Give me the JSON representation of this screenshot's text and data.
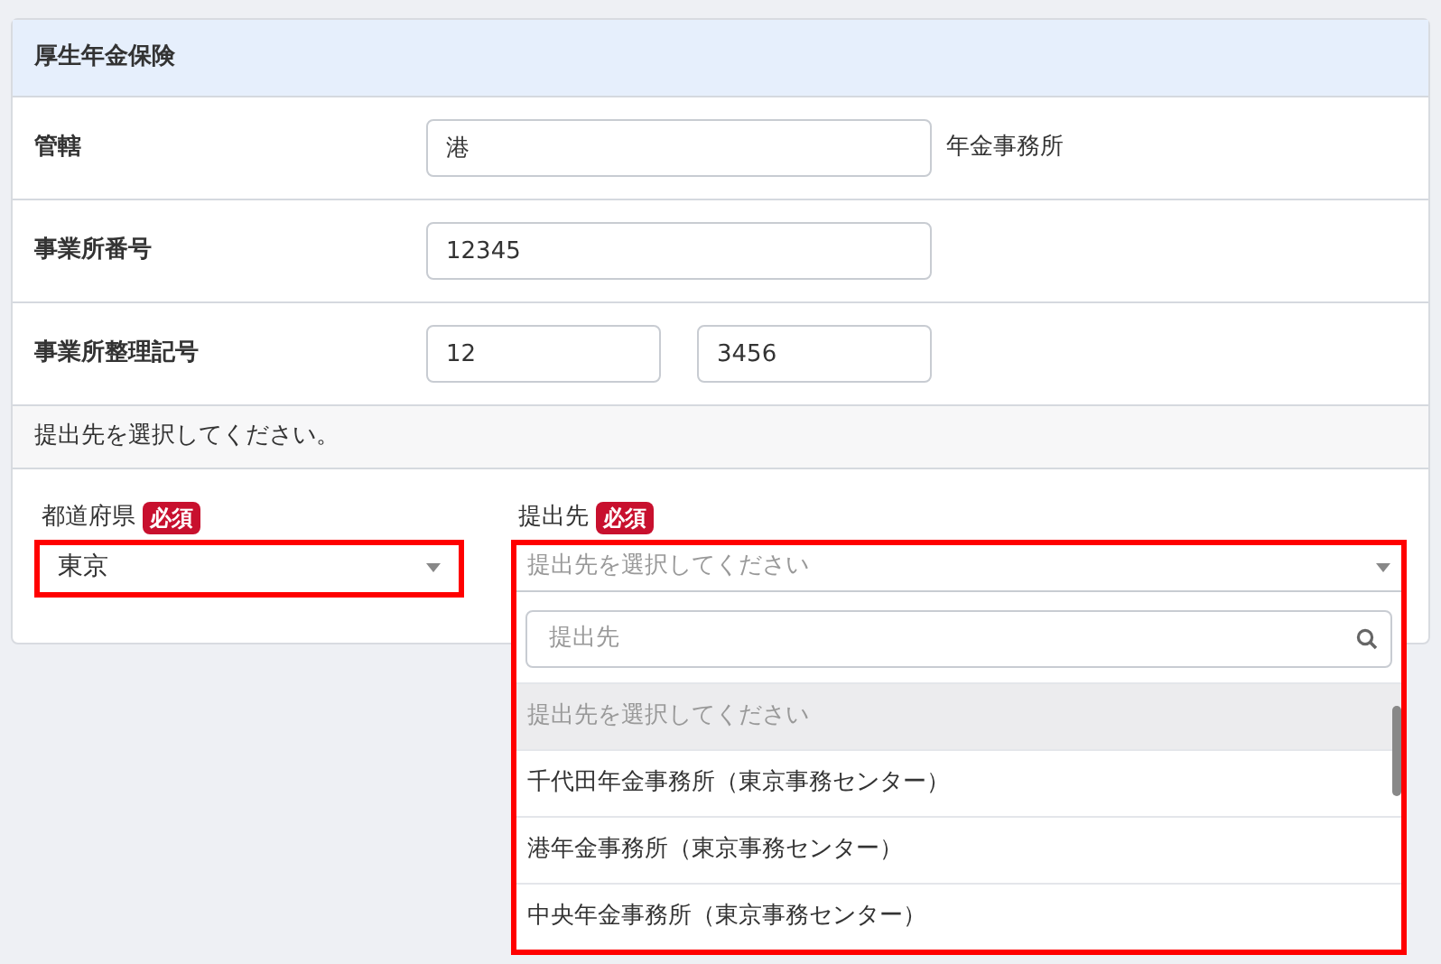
{
  "section": {
    "title": "厚生年金保険"
  },
  "rows": [
    {
      "label": "管轄",
      "fields": [
        {
          "value": "港",
          "kind": "wide"
        }
      ],
      "suffix": "年金事務所"
    },
    {
      "label": "事業所番号",
      "fields": [
        {
          "value": "12345",
          "kind": "wide"
        }
      ]
    },
    {
      "label": "事業所整理記号",
      "fields": [
        {
          "value": "12",
          "kind": "narrow"
        },
        {
          "value": "3456",
          "kind": "narrow"
        }
      ]
    }
  ],
  "notice": "提出先を選択してください。",
  "prefecture": {
    "label": "都道府県",
    "badge": "必須",
    "value": "東京",
    "highlighted": true
  },
  "destination": {
    "label": "提出先",
    "badge": "必須",
    "placeholder": "提出先を選択してください",
    "highlighted": true,
    "expanded": true,
    "search": {
      "placeholder": "提出先"
    },
    "options": [
      {
        "text": "提出先を選択してください",
        "kind": "placeholder",
        "selected": true
      },
      {
        "text": "千代田年金事務所（東京事務センター）",
        "kind": "option",
        "selected": false
      },
      {
        "text": "港年金事務所（東京事務センター）",
        "kind": "option",
        "selected": false
      },
      {
        "text": "中央年金事務所（東京事務センター）",
        "kind": "option",
        "selected": false
      }
    ]
  }
}
